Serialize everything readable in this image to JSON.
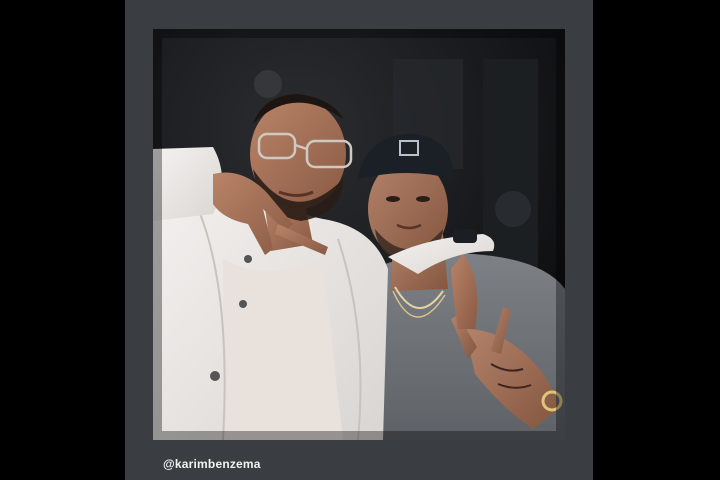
{
  "story": {
    "caption": "@karimbenzema"
  },
  "colors": {
    "page_background": "#000000",
    "card_background": "#3a3d42",
    "caption_text": "#f2f2f2"
  }
}
